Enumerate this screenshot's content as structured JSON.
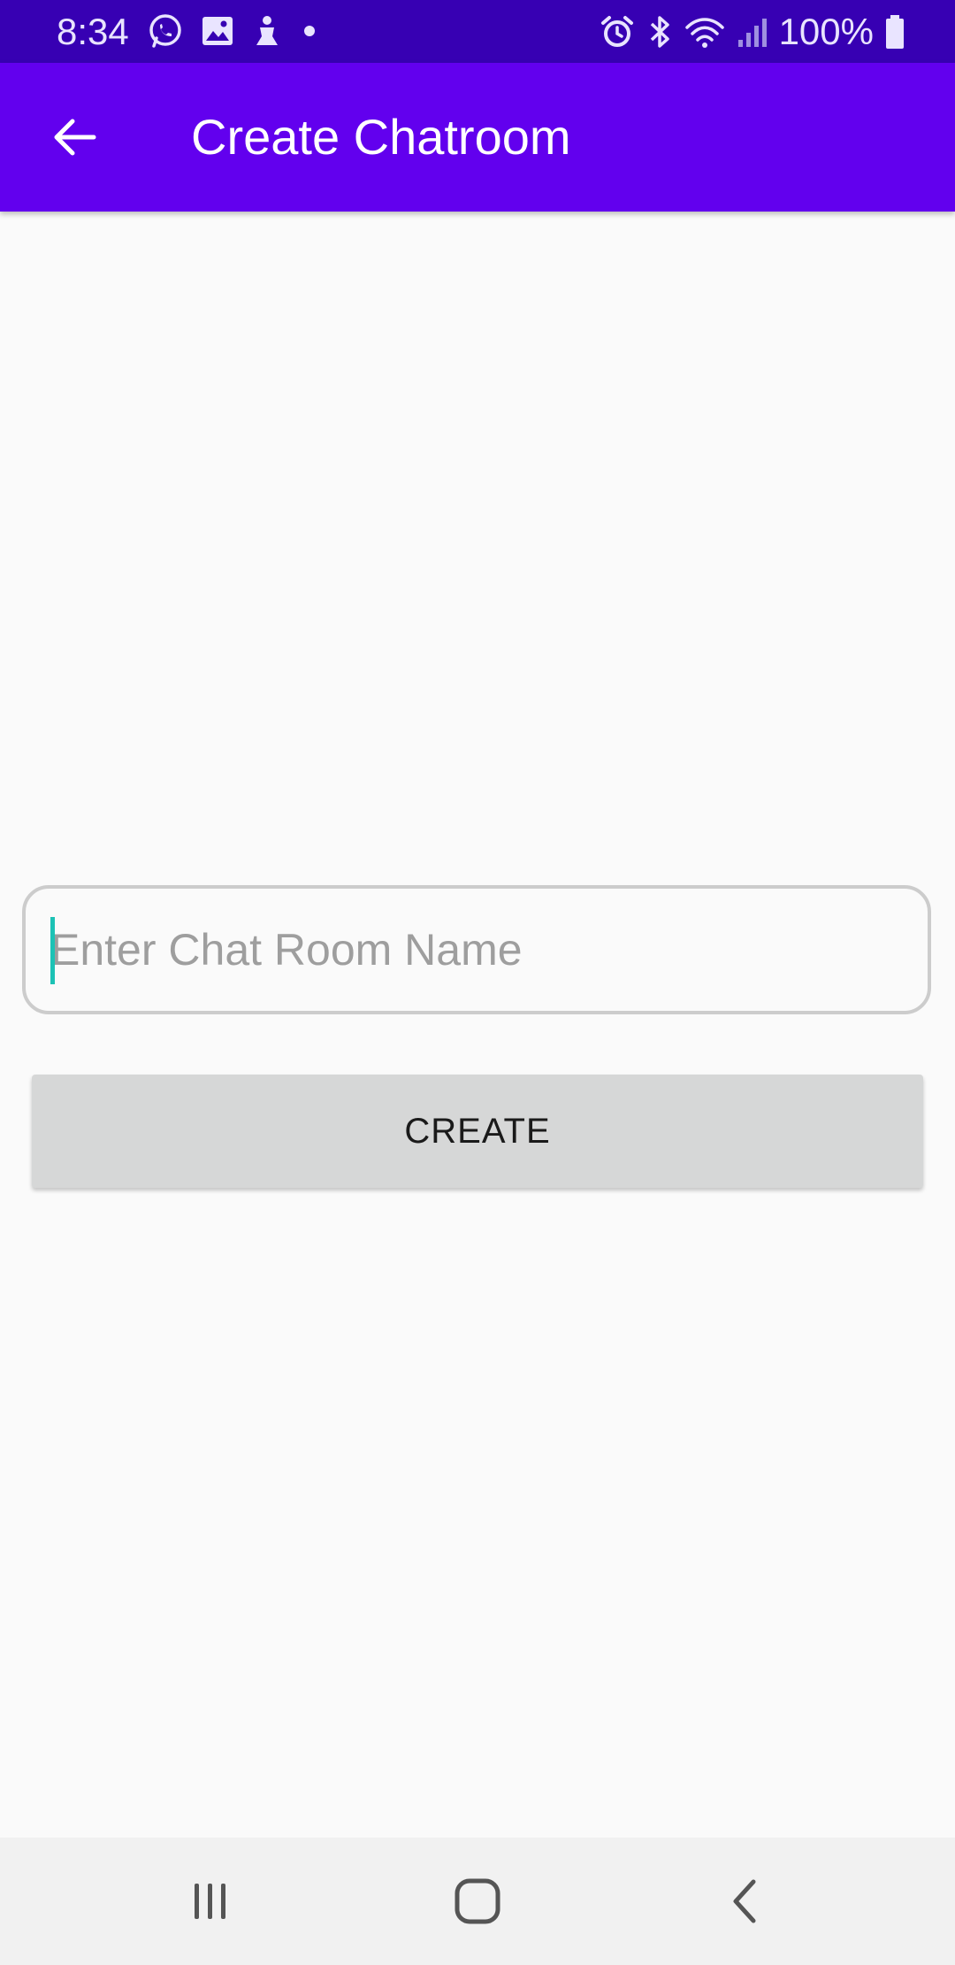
{
  "status_bar": {
    "time": "8:34",
    "left_icons": [
      "whatsapp-icon",
      "gallery-icon",
      "notification-app-icon",
      "dot-icon"
    ],
    "right_icons": [
      "alarm-icon",
      "bluetooth-icon",
      "wifi-icon",
      "signal-icon",
      "battery-icon"
    ],
    "battery": "100%",
    "background": "#3700b3"
  },
  "app_bar": {
    "title": "Create Chatroom",
    "back_icon": "back-arrow-icon",
    "background": "#6200ee"
  },
  "form": {
    "room_name": {
      "value": "",
      "placeholder": "Enter Chat Room Name"
    },
    "create_label": "CREATE"
  },
  "nav_bar": {
    "items": [
      "recent-apps-icon",
      "home-icon",
      "back-icon"
    ]
  },
  "colors": {
    "accent": "#1cc2b5",
    "button": "#d6d7d7"
  }
}
